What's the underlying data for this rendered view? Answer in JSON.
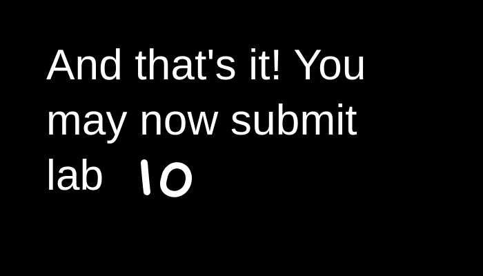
{
  "screen": {
    "background_color": "#000000",
    "text_color": "#ffffff",
    "message": {
      "line_1": "And that's it! You",
      "line_2": "may now submit",
      "line_3": "lab",
      "handwritten_number": "10"
    }
  }
}
